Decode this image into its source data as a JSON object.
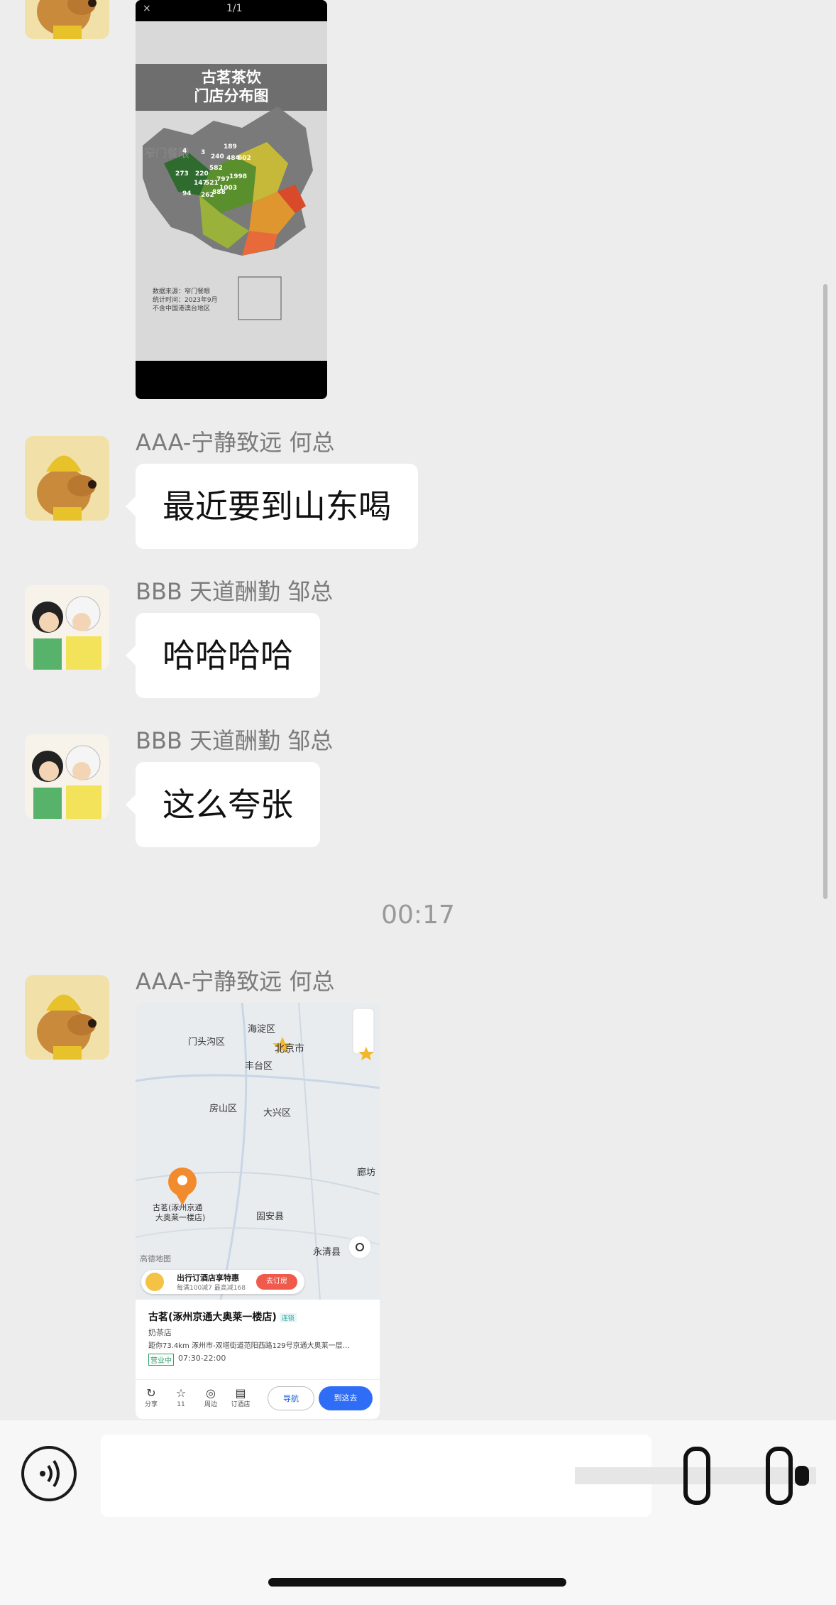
{
  "messages": [
    {
      "type": "image",
      "sender": "",
      "image": {
        "counter": "1/1",
        "close": "×",
        "title_line1": "古茗茶饮",
        "title_line2": "门店分布图",
        "watermark": "窄门餐眼",
        "note_line1": "数据来源：窄门餐眼",
        "note_line2": "统计时间：2023年9月",
        "note_line3": "不含中国港澳台地区",
        "map_numbers": [
          "4",
          "3",
          "240",
          "189",
          "273",
          "220",
          "582",
          "484",
          "602",
          "147",
          "521",
          "797",
          "1998",
          "94",
          "1003",
          "262",
          "888"
        ]
      }
    },
    {
      "type": "text",
      "sender": "AAA-宁静致远 何总",
      "text": "最近要到山东喝"
    },
    {
      "type": "text",
      "sender": "BBB 天道酬勤 邹总",
      "text": "哈哈哈哈"
    },
    {
      "type": "text",
      "sender": "BBB 天道酬勤 邹总",
      "text": "这么夸张"
    },
    {
      "type": "location",
      "sender": "AAA-宁静致远 何总"
    }
  ],
  "timestamp": "00:17",
  "map": {
    "districts": [
      "海淀区",
      "北京市",
      "门头沟区",
      "丰台区",
      "房山区",
      "大兴区",
      "廊坊",
      "固安县",
      "永清县"
    ],
    "pin_label_line1": "古茗(涿州京通",
    "pin_label_line2": "大奥莱一楼店)",
    "map_logo": "高德地图",
    "promo_title": "出行订酒店享特惠",
    "promo_sub": "每满100减7 最高减168",
    "promo_button": "去订房",
    "shop_name": "古茗(涿州京通大奥莱一楼店)",
    "shop_chain": "连锁",
    "shop_category": "奶茶店",
    "shop_address": "距你73.4km  涿州市-双塔街道范阳西路129号京通大奥莱一层…",
    "shop_status": "营业中",
    "shop_hours": "07:30-22:00",
    "tools": [
      {
        "glyph": "↻",
        "label": "分享"
      },
      {
        "glyph": "☆",
        "label": "11"
      },
      {
        "glyph": "◎",
        "label": "周边"
      },
      {
        "glyph": "▤",
        "label": "订酒店"
      }
    ],
    "nav_button": "导航",
    "go_button": "到这去"
  },
  "colors": {
    "background": "#ededed",
    "bubble": "#ffffff",
    "accent_blue": "#2f6df6",
    "promo_red": "#f05a4c"
  }
}
